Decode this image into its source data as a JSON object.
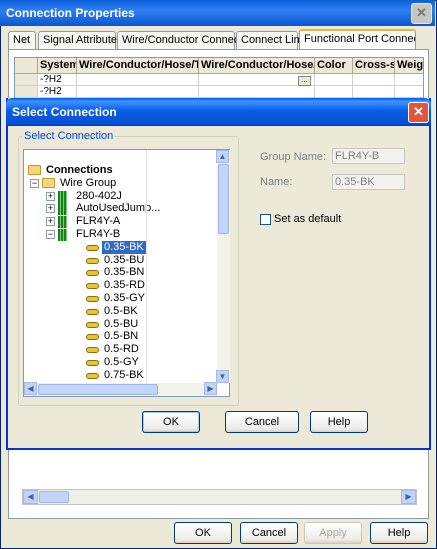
{
  "outer": {
    "title": "Connection Properties",
    "tabs": [
      "Net",
      "Signal Attributes",
      "Wire/Conductor Connections",
      "Connect Lines",
      "Functional Port Connections"
    ],
    "active_tab": "Functional Port Connections",
    "grid": {
      "columns": [
        "System",
        "Wire/Conductor/Hose/Tube",
        "Wire/Conductor/Hose/Tube",
        "Color",
        "Cross-s",
        "Weig"
      ],
      "rows": [
        [
          "-?H2",
          "",
          "",
          "",
          "",
          ""
        ],
        [
          "-?H2",
          "",
          "",
          "",
          "",
          ""
        ]
      ],
      "ellipsis": "..."
    },
    "buttons": {
      "ok": "OK",
      "cancel": "Cancel",
      "apply": "Apply",
      "help": "Help"
    }
  },
  "dialog": {
    "title": "Select Connection",
    "group_label": "Select Connection",
    "tree": [
      {
        "label": "Connections",
        "level": 0,
        "icon": "folder-icon",
        "expand": "",
        "bold": true
      },
      {
        "label": "Wire Group",
        "level": 1,
        "icon": "folder-icon",
        "expand": "-"
      },
      {
        "label": "280-402J",
        "level": 2,
        "icon": "wire-group-icon",
        "expand": "+"
      },
      {
        "label": "AutoUsedJump...",
        "level": 2,
        "icon": "wire-group-icon",
        "expand": "+"
      },
      {
        "label": "FLR4Y-A",
        "level": 2,
        "icon": "wire-group-icon",
        "expand": "+"
      },
      {
        "label": "FLR4Y-B",
        "level": 2,
        "icon": "wire-group-icon",
        "expand": "-"
      },
      {
        "label": "0.35-BK",
        "level": 3,
        "icon": "cable-icon",
        "expand": "",
        "selected": true
      },
      {
        "label": "0.35-BU",
        "level": 3,
        "icon": "cable-icon",
        "expand": ""
      },
      {
        "label": "0.35-BN",
        "level": 3,
        "icon": "cable-icon",
        "expand": ""
      },
      {
        "label": "0.35-RD",
        "level": 3,
        "icon": "cable-icon",
        "expand": ""
      },
      {
        "label": "0.35-GY",
        "level": 3,
        "icon": "cable-icon",
        "expand": ""
      },
      {
        "label": "0.5-BK",
        "level": 3,
        "icon": "cable-icon",
        "expand": ""
      },
      {
        "label": "0.5-BU",
        "level": 3,
        "icon": "cable-icon",
        "expand": ""
      },
      {
        "label": "0.5-BN",
        "level": 3,
        "icon": "cable-icon",
        "expand": ""
      },
      {
        "label": "0.5-RD",
        "level": 3,
        "icon": "cable-icon",
        "expand": ""
      },
      {
        "label": "0.5-GY",
        "level": 3,
        "icon": "cable-icon",
        "expand": ""
      },
      {
        "label": "0.75-BK",
        "level": 3,
        "icon": "cable-icon",
        "expand": ""
      }
    ],
    "group_name_label": "Group Name:",
    "group_name_value": "FLR4Y-B",
    "name_label": "Name:",
    "name_value": "0.35-BK",
    "set_default_label": "Set as default",
    "set_default_checked": false,
    "buttons": {
      "ok": "OK",
      "cancel": "Cancel",
      "help": "Help"
    }
  }
}
